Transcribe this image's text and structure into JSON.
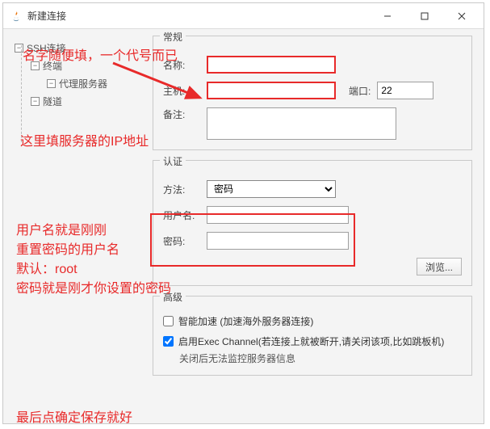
{
  "window": {
    "title": "新建连接"
  },
  "tree": {
    "root": "SSH连接",
    "items": [
      "终端",
      "代理服务器",
      "隧道"
    ]
  },
  "general": {
    "legend": "常规",
    "name_label": "名称:",
    "name_value": "",
    "host_label": "主机:",
    "host_value": "",
    "port_label": "端口:",
    "port_value": "22",
    "note_label": "备注:",
    "note_value": ""
  },
  "auth": {
    "legend": "认证",
    "method_label": "方法:",
    "method_value": "密码",
    "user_label": "用户名:",
    "user_value": "",
    "pass_label": "密码:",
    "pass_value": "",
    "browse": "浏览..."
  },
  "advanced": {
    "legend": "高级",
    "accel_label": "智能加速 (加速海外服务器连接)",
    "accel_checked": false,
    "exec_label": "启用Exec Channel(若连接上就被断开,请关闭该项,比如跳板机)",
    "exec_note": "关闭后无法监控服务器信息",
    "exec_checked": true
  },
  "annotations": {
    "name_hint": "名字随便填，一个代号而已",
    "host_hint": "这里填服务器的IP地址",
    "user_hint1": "用户名就是刚刚",
    "user_hint2": "重置密码的用户名",
    "user_hint3": "默认：root",
    "pass_hint": "密码就是刚才你设置的密码",
    "save_hint": "最后点确定保存就好"
  }
}
